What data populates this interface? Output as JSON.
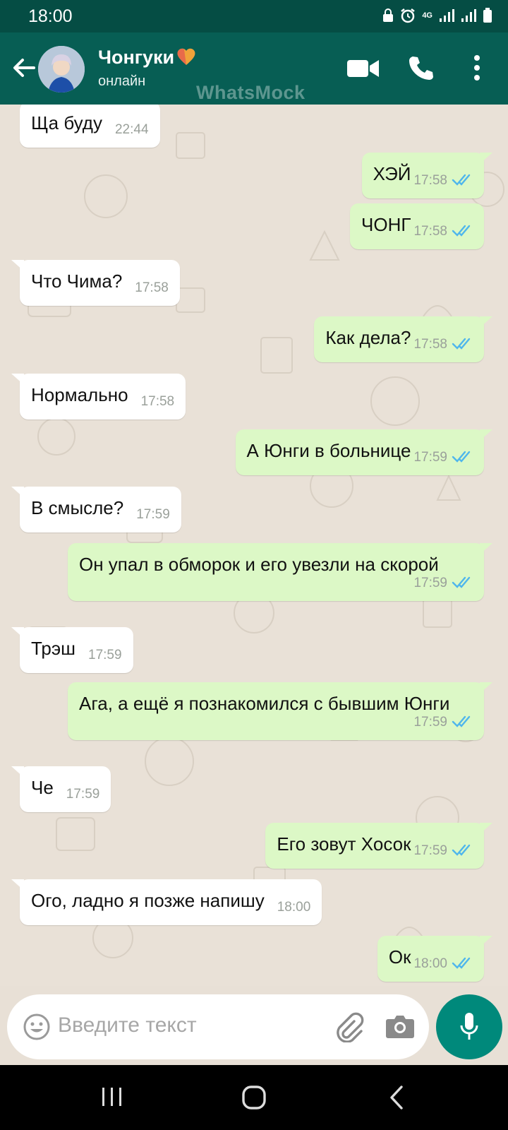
{
  "status_bar": {
    "time": "18:00",
    "network_label": "4G"
  },
  "header": {
    "contact_name": "Чонгуки",
    "contact_status": "онлайн",
    "watermark": "WhatsMock"
  },
  "messages": [
    {
      "dir": "in",
      "text": "Ща буду",
      "time": "22:44"
    },
    {
      "dir": "out",
      "text": "ХЭЙ",
      "time": "17:58",
      "read": true
    },
    {
      "dir": "out",
      "text": "ЧОНГ",
      "time": "17:58",
      "read": true
    },
    {
      "dir": "in",
      "text": "Что Чима?",
      "time": "17:58"
    },
    {
      "dir": "out",
      "text": "Как дела?",
      "time": "17:58",
      "read": true
    },
    {
      "dir": "in",
      "text": "Нормально",
      "time": "17:58"
    },
    {
      "dir": "out",
      "text": "А Юнги в больнице",
      "time": "17:59",
      "read": true
    },
    {
      "dir": "in",
      "text": "В смысле?",
      "time": "17:59"
    },
    {
      "dir": "out",
      "text": "Он упал в обморок и его увезли на скорой",
      "time": "17:59",
      "read": true
    },
    {
      "dir": "in",
      "text": "Трэш",
      "time": "17:59"
    },
    {
      "dir": "out",
      "text": "Ага, а ещё я познакомился с бывшим Юнги",
      "time": "17:59",
      "read": true
    },
    {
      "dir": "in",
      "text": "Че",
      "time": "17:59"
    },
    {
      "dir": "out",
      "text": "Его зовут Хосок",
      "time": "17:59",
      "read": true
    },
    {
      "dir": "in",
      "text": "Ого, ладно я позже напишу",
      "time": "18:00"
    },
    {
      "dir": "out",
      "text": "Ок",
      "time": "18:00",
      "read": true
    }
  ],
  "composer": {
    "placeholder": "Введите текст"
  },
  "icons": {
    "header": [
      "back-arrow-icon",
      "avatar",
      "heart-emoji-icon",
      "video-call-icon",
      "phone-icon",
      "more-vert-icon"
    ],
    "composer": [
      "emoji-icon",
      "attach-icon",
      "camera-icon",
      "mic-icon"
    ],
    "nav": [
      "recent-apps-icon",
      "home-icon",
      "nav-back-icon"
    ]
  },
  "colors": {
    "header": "#075e54",
    "status_bar": "#054d44",
    "outgoing_bubble": "#dcf8c6",
    "incoming_bubble": "#ffffff",
    "read_ticks": "#4fb6ec",
    "mic_button": "#00897b"
  }
}
